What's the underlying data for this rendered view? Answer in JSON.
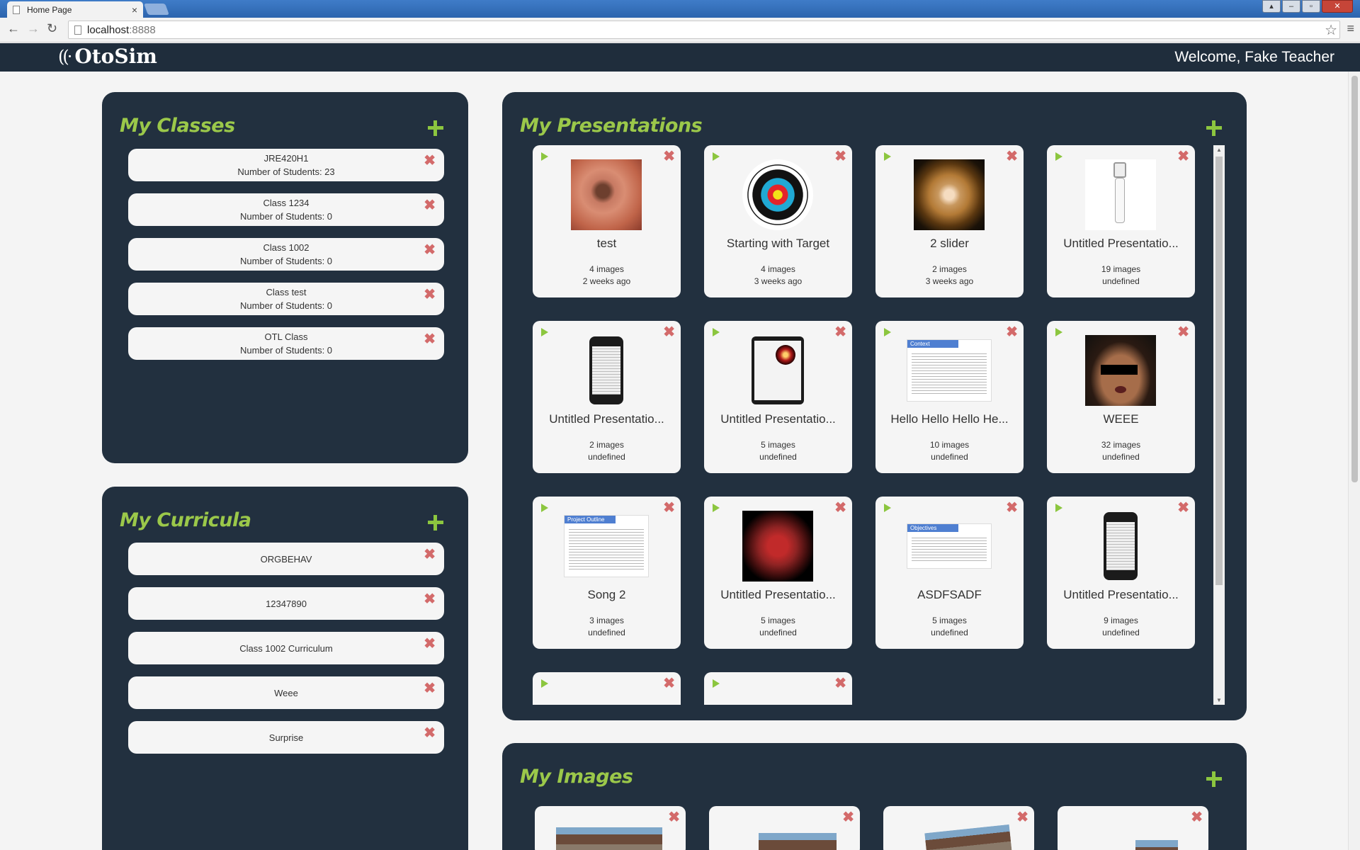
{
  "browser": {
    "tab_title": "Home Page",
    "tab_close": "×",
    "url_host": "localhost",
    "url_port": ":8888"
  },
  "app": {
    "logo_text": "OtoSim",
    "welcome": "Welcome, Fake Teacher"
  },
  "classes": {
    "heading": "My Classes",
    "items": [
      {
        "name": "JRE420H1",
        "students": "Number of Students: 23"
      },
      {
        "name": "Class 1234",
        "students": "Number of Students: 0"
      },
      {
        "name": "Class 1002",
        "students": "Number of Students: 0"
      },
      {
        "name": "Class test",
        "students": "Number of Students: 0"
      },
      {
        "name": "OTL Class",
        "students": "Number of Students: 0"
      }
    ]
  },
  "curricula": {
    "heading": "My Curricula",
    "items": [
      "ORGBEHAV",
      "12347890",
      "Class 1002 Curriculum",
      "Weee",
      "Surprise"
    ]
  },
  "presentations": {
    "heading": "My Presentations",
    "items": [
      {
        "title": "test",
        "images": "4 images",
        "date": "2 weeks ago",
        "thumb": "ear-canal-red"
      },
      {
        "title": "Starting with Target",
        "images": "4 images",
        "date": "3 weeks ago",
        "thumb": "target"
      },
      {
        "title": "2 slider",
        "images": "2 images",
        "date": "3 weeks ago",
        "thumb": "ear-canal-dark"
      },
      {
        "title": "Untitled Presentatio...",
        "images": "19 images",
        "date": "undefined",
        "thumb": "otoscope-sketch"
      },
      {
        "title": "Untitled Presentatio...",
        "images": "2 images",
        "date": "undefined",
        "thumb": "phone"
      },
      {
        "title": "Untitled Presentatio...",
        "images": "5 images",
        "date": "undefined",
        "thumb": "tablet"
      },
      {
        "title": "Hello Hello Hello He...",
        "images": "10 images",
        "date": "undefined",
        "thumb": "slide-context"
      },
      {
        "title": "WEEE",
        "images": "32 images",
        "date": "undefined",
        "thumb": "face"
      },
      {
        "title": "Song 2",
        "images": "3 images",
        "date": "undefined",
        "thumb": "slide-project-outline"
      },
      {
        "title": "Untitled Presentatio...",
        "images": "5 images",
        "date": "undefined",
        "thumb": "ear-canal-bright"
      },
      {
        "title": "ASDFSADF",
        "images": "5 images",
        "date": "undefined",
        "thumb": "slide-objectives"
      },
      {
        "title": "Untitled Presentatio...",
        "images": "9 images",
        "date": "undefined",
        "thumb": "phone"
      }
    ],
    "slide_headers": {
      "context": "Context",
      "project": "Project Outline",
      "objectives": "Objectives"
    }
  },
  "images": {
    "heading": "My Images"
  },
  "icons": {
    "delete": "✖",
    "add": "plus-icon",
    "play": "play-icon"
  },
  "colors": {
    "panel": "#22303f",
    "heading_green": "#9bc84a",
    "add_green": "#8cc63f",
    "delete_red": "#d36a6a",
    "appbar": "#1f2d3c"
  }
}
